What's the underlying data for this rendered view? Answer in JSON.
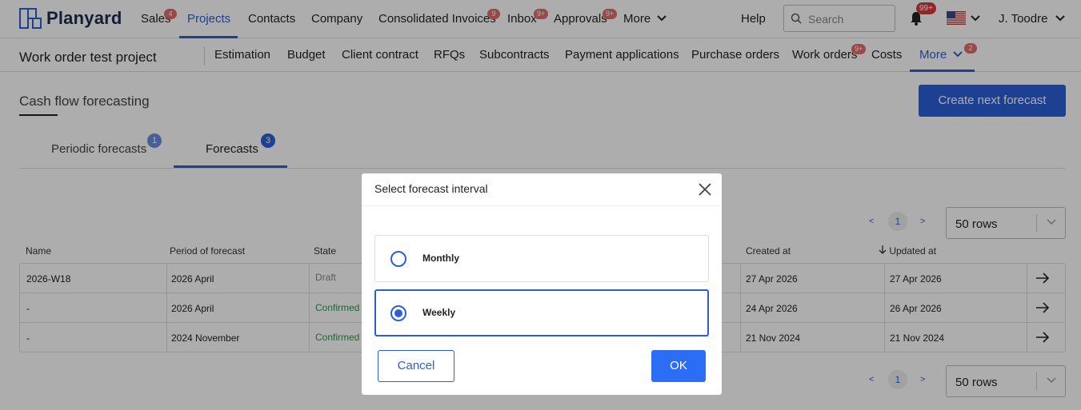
{
  "topnav": {
    "logo_text": "Planyard",
    "items": [
      {
        "label": "Sales",
        "badge": "4"
      },
      {
        "label": "Projects",
        "badge": ""
      },
      {
        "label": "Contacts",
        "badge": ""
      },
      {
        "label": "Company",
        "badge": ""
      },
      {
        "label": "Consolidated Invoices",
        "badge": "9"
      },
      {
        "label": "Inbox",
        "badge": "9+"
      },
      {
        "label": "Approvals",
        "badge": "9+"
      },
      {
        "label": "More",
        "badge": ""
      }
    ],
    "help": "Help",
    "search_placeholder": "Search",
    "notifications_badge": "99+",
    "user": "J. Toodre"
  },
  "subnav": {
    "project_title": "Work order test project",
    "items": [
      {
        "label": "Estimation"
      },
      {
        "label": "Budget"
      },
      {
        "label": "Client contract"
      },
      {
        "label": "RFQs"
      },
      {
        "label": "Subcontracts"
      },
      {
        "label": "Payment applications"
      },
      {
        "label": "Purchase orders"
      },
      {
        "label": "Work orders",
        "badge": "9+"
      },
      {
        "label": "Costs"
      },
      {
        "label": "More",
        "badge": "2"
      }
    ]
  },
  "page": {
    "title": "Cash flow forecasting",
    "create_button": "Create next forecast",
    "tabs": [
      {
        "label": "Periodic forecasts",
        "badge": "1"
      },
      {
        "label": "Forecasts",
        "badge": "3"
      }
    ],
    "pager": {
      "prev": "<",
      "page": "1",
      "next": ">",
      "rows": "50 rows"
    }
  },
  "table": {
    "headers": [
      "Name",
      "Period of forecast",
      "State",
      "Created at",
      "Updated at"
    ],
    "rows": [
      {
        "name": "2026-W18",
        "period": "2026 April",
        "state": "Draft",
        "created": "27 Apr 2026",
        "updated": "27 Apr 2026"
      },
      {
        "name": "-",
        "period": "2026 April",
        "state": "Confirmed",
        "created": "24 Apr 2026",
        "updated": "26 Apr 2026"
      },
      {
        "name": "-",
        "period": "2024 November",
        "state": "Confirmed",
        "created": "21 Nov 2024",
        "updated": "21 Nov 2024"
      }
    ]
  },
  "modal": {
    "title": "Select forecast interval",
    "options": [
      {
        "label": "Monthly",
        "selected": false
      },
      {
        "label": "Weekly",
        "selected": true
      }
    ],
    "cancel": "Cancel",
    "ok": "OK"
  },
  "colors": {
    "accent": "#2b5fd9",
    "badge": "#e04646",
    "confirmed": "#2e9a4a",
    "overlay": "rgba(0,0,0,0.32)"
  }
}
